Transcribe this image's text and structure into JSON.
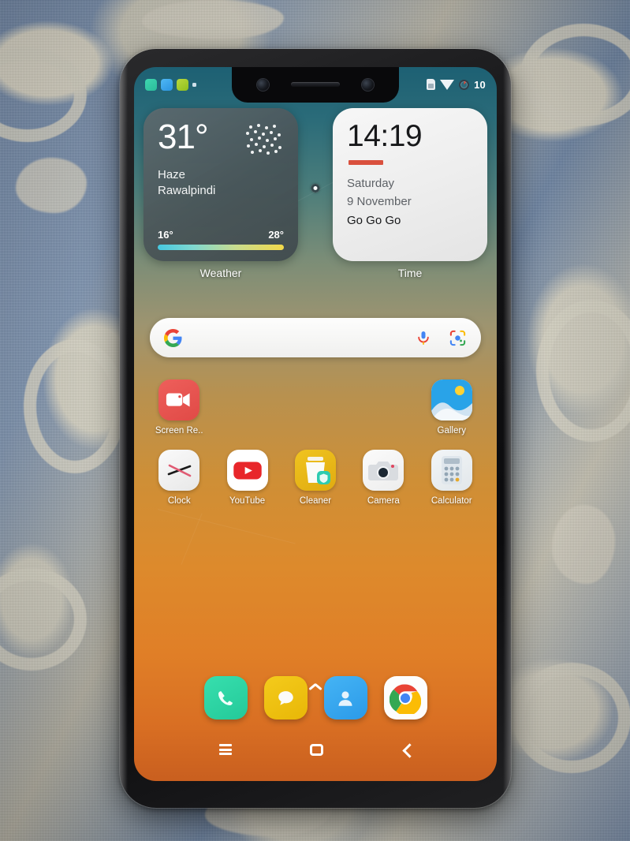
{
  "device": {
    "type": "smartphone",
    "orientation": "portrait",
    "notch": true,
    "screen_cracked": true
  },
  "status_bar": {
    "notification_icons": [
      "notification-app-teal",
      "notification-app-blue",
      "notification-app-green"
    ],
    "sim_icon": "sim-card-icon",
    "wifi_icon": "wifi-icon",
    "battery_icon": "battery-circle-icon",
    "battery_percent": "10"
  },
  "widgets": {
    "weather": {
      "label": "Weather",
      "temperature": "31°",
      "condition": "Haze",
      "city": "Rawalpindi",
      "low": "16°",
      "high": "28°",
      "icon": "haze-icon",
      "bar_gradient_from": "#46c8e0",
      "bar_gradient_to": "#f2d94a"
    },
    "time": {
      "label": "Time",
      "clock": "14:19",
      "weekday": "Saturday",
      "date": "9 November",
      "note": "Go Go Go",
      "rule_color": "#d9503e"
    },
    "page_indicator": "page-dot"
  },
  "search": {
    "provider_icon": "google-g-icon",
    "mic_icon": "microphone-icon",
    "lens_icon": "google-lens-icon",
    "placeholder": ""
  },
  "apps": {
    "rows": [
      [
        {
          "label": "Screen Re..",
          "icon": "screen-recorder-icon",
          "color": "#e8524f"
        },
        {
          "label": "",
          "icon": "",
          "color": ""
        },
        {
          "label": "",
          "icon": "",
          "color": ""
        },
        {
          "label": "",
          "icon": "",
          "color": ""
        },
        {
          "label": "Gallery",
          "icon": "gallery-icon",
          "color": "#2d9cdb"
        }
      ],
      [
        {
          "label": "Clock",
          "icon": "clock-icon",
          "color": "#f2f2f2"
        },
        {
          "label": "YouTube",
          "icon": "youtube-icon",
          "color": "#ffffff"
        },
        {
          "label": "Cleaner",
          "icon": "cleaner-icon",
          "color": "#e8b91d"
        },
        {
          "label": "Camera",
          "icon": "camera-icon",
          "color": "#f0f0f0"
        },
        {
          "label": "Calculator",
          "icon": "calculator-icon",
          "color": "#eceff1"
        }
      ]
    ]
  },
  "drawer_indicator": "chevron-up-icon",
  "dock": {
    "items": [
      {
        "label": "Phone",
        "icon": "phone-icon",
        "color": "#2ed6a5"
      },
      {
        "label": "Messages",
        "icon": "message-bubble-icon",
        "color": "#f0c419"
      },
      {
        "label": "Contacts",
        "icon": "contacts-person-icon",
        "color": "#36a9f0"
      },
      {
        "label": "Chrome",
        "icon": "chrome-icon",
        "color": "#ffffff"
      }
    ]
  },
  "nav_bar": {
    "recents_icon": "recents-menu-icon",
    "home_icon": "home-square-icon",
    "back_icon": "back-chevron-icon"
  },
  "wallpaper": {
    "gradient_top": "#1d6073",
    "gradient_mid": "#b8914f",
    "gradient_bottom": "#c95f1f"
  },
  "background": {
    "surface": "patterned-fabric",
    "colors": [
      "#6f86a6",
      "#d6d2c2"
    ]
  }
}
